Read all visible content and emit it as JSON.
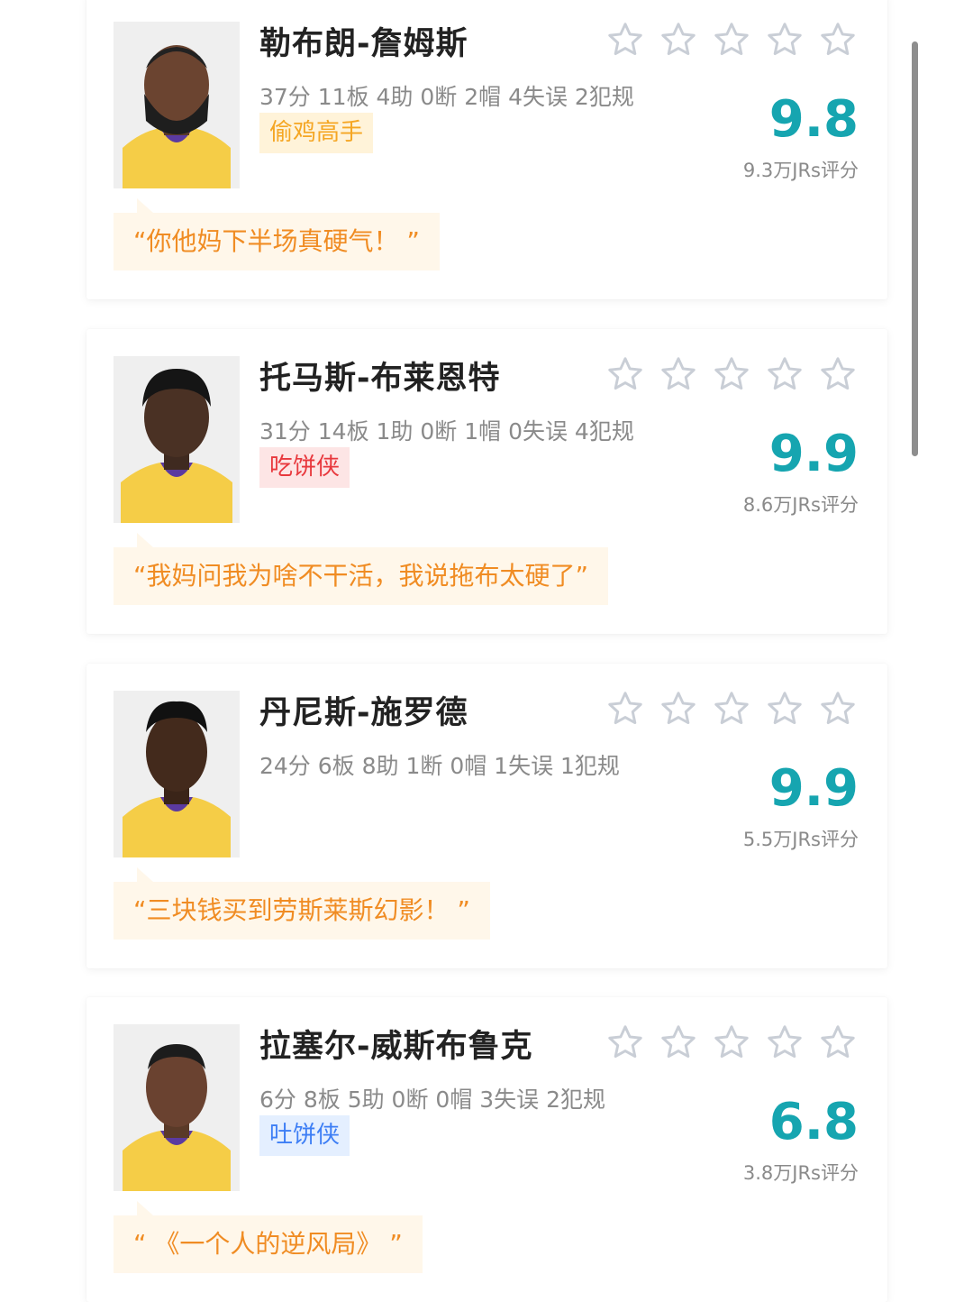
{
  "colors": {
    "score": "#16a5b0",
    "comment_text": "#f08c23",
    "comment_bg": "#fff7ea",
    "star_outline": "#c9ced6",
    "jersey": "#f5cd47"
  },
  "players": [
    {
      "name": "勒布朗-詹姆斯",
      "stats": "37分 11板 4助 0断 2帽 4失误 2犯规",
      "badge": "偷鸡高手",
      "badge_color": "gold",
      "score": "9.8",
      "rating_count": "9.3万JRs评分",
      "comment": "“你他妈下半场真硬气！ ”",
      "avatar_icon": "player-headshot-icon",
      "stars_filled": 0
    },
    {
      "name": "托马斯-布莱恩特",
      "stats": "31分 14板 1助 0断 1帽 0失误 4犯规",
      "badge": "吃饼侠",
      "badge_color": "red",
      "score": "9.9",
      "rating_count": "8.6万JRs评分",
      "comment": "“我妈问我为啥不干活，我说拖布太硬了”",
      "avatar_icon": "player-headshot-icon",
      "stars_filled": 0
    },
    {
      "name": "丹尼斯-施罗德",
      "stats": "24分 6板 8助 1断 0帽 1失误 1犯规",
      "badge": "",
      "badge_color": "",
      "score": "9.9",
      "rating_count": "5.5万JRs评分",
      "comment": "“三块钱买到劳斯莱斯幻影！ ”",
      "avatar_icon": "player-headshot-icon",
      "stars_filled": 0
    },
    {
      "name": "拉塞尔-威斯布鲁克",
      "stats": "6分 8板 5助 0断 0帽 3失误 2犯规",
      "badge": "吐饼侠",
      "badge_color": "blue",
      "score": "6.8",
      "rating_count": "3.8万JRs评分",
      "comment": "“ 《一个人的逆风局》 ”",
      "avatar_icon": "player-headshot-icon",
      "stars_filled": 0
    }
  ]
}
